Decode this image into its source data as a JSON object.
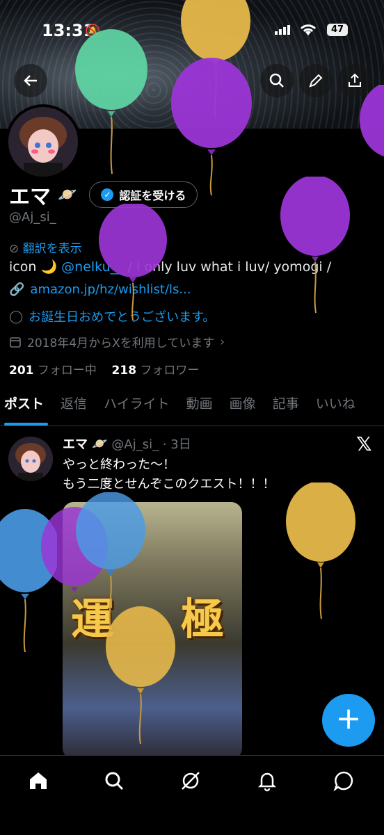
{
  "status_bar": {
    "time": "13:31",
    "battery": "47"
  },
  "header_icons": [
    "back-arrow-icon",
    "search-icon",
    "edit-icon",
    "share-icon"
  ],
  "profile": {
    "name": "エマ",
    "planet": "🪐",
    "verify_label": "認証を受ける",
    "handle": "@Aj_si_",
    "translate_label": "翻訳を表示",
    "bio_prefix": "icon ",
    "bio_moon": "🌙",
    "bio_mention": "@nelku__",
    "bio_rest": " / i only luv what i luv/ yomogi /",
    "link": "amazon.jp/hz/wishlist/ls...",
    "birthday": "お誕生日おめでとうございます。",
    "joined": "2018年4月からXを利用しています",
    "following_count": "201",
    "following_label": "フォロー中",
    "followers_count": "218",
    "followers_label": "フォロワー"
  },
  "tabs": [
    "ポスト",
    "返信",
    "ハイライト",
    "動画",
    "画像",
    "記事",
    "いいね"
  ],
  "post": {
    "name": "エマ",
    "planet": "🪐",
    "handle_time": "@Aj_si_ · 3日",
    "text": "やっと終わった〜！\nもう二度とせんぞこのクエスト！！！",
    "media_kanji_left": "運",
    "media_kanji_right": "極"
  },
  "fab_label": "+",
  "nav": [
    "home-icon",
    "search-icon",
    "grok-icon",
    "notifications-icon",
    "messages-icon"
  ],
  "colors": {
    "accent": "#1d9bf0",
    "balloon_green": "#5ed6a4",
    "balloon_purple": "#9b35d6",
    "balloon_yellow": "#e6b84a",
    "balloon_blue": "#4a9be6"
  }
}
